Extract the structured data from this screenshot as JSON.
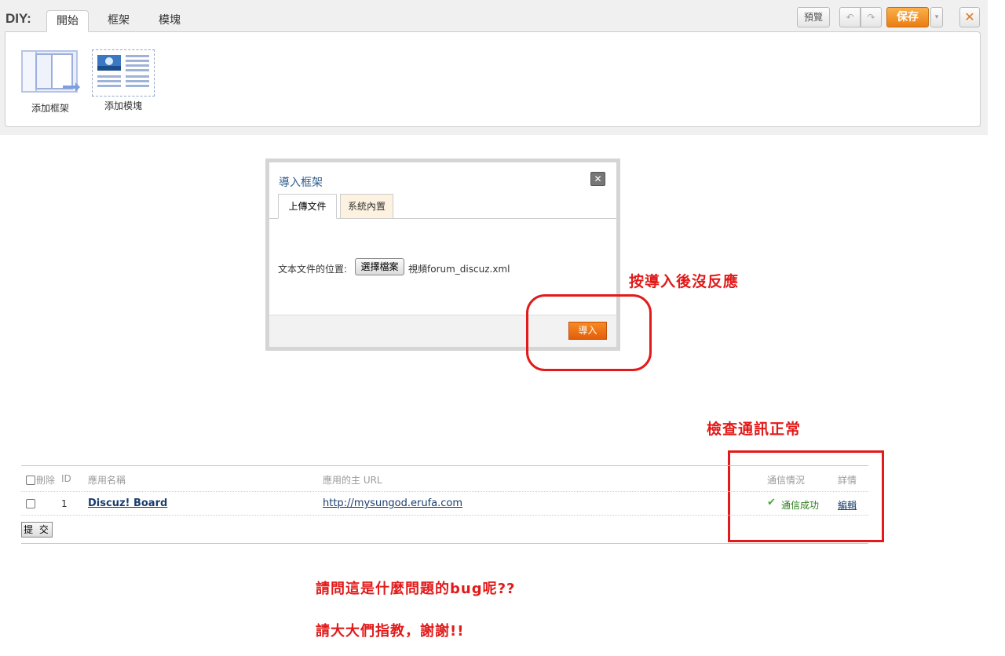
{
  "diy": {
    "label": "DIY:",
    "tabs": [
      "開始",
      "框架",
      "模塊"
    ],
    "tools": [
      {
        "label": "添加框架",
        "icon": "frame-icon"
      },
      {
        "label": "添加模塊",
        "icon": "block-icon"
      }
    ],
    "buttons": {
      "preview": "預覽",
      "undo": "↶",
      "redo": "↷",
      "save": "保存",
      "save_menu": "▾",
      "close": "✕"
    }
  },
  "dialog": {
    "title": "導入框架",
    "close": "✕",
    "tabs": [
      "上傳文件",
      "系統內置"
    ],
    "file_label": "文本文件的位置:",
    "file_button": "選擇檔案",
    "file_name": "視頻forum_discuz.xml",
    "import_button": "導入"
  },
  "annotations": {
    "no_response": "按導入後沒反應",
    "comm_ok": "檢查通訊正常",
    "question": "請問這是什麼問題的bug呢??",
    "thanks": "請大大們指教，謝謝!!"
  },
  "app_table": {
    "headers": {
      "delete": "刪除",
      "id": "ID",
      "name": "應用名稱",
      "url": "應用的主 URL",
      "status": "通信情況",
      "detail": "詳情"
    },
    "rows": [
      {
        "id": "1",
        "name": "Discuz! Board",
        "url": "http://mysungod.erufa.com",
        "status": "通信成功",
        "action": "編輯"
      }
    ],
    "submit": "提 交"
  },
  "colors": {
    "accent_orange": "#ea7d12",
    "annotation_red": "#e21a1a",
    "success_green": "#4aa43a",
    "link_blue": "#1a3d6e"
  }
}
